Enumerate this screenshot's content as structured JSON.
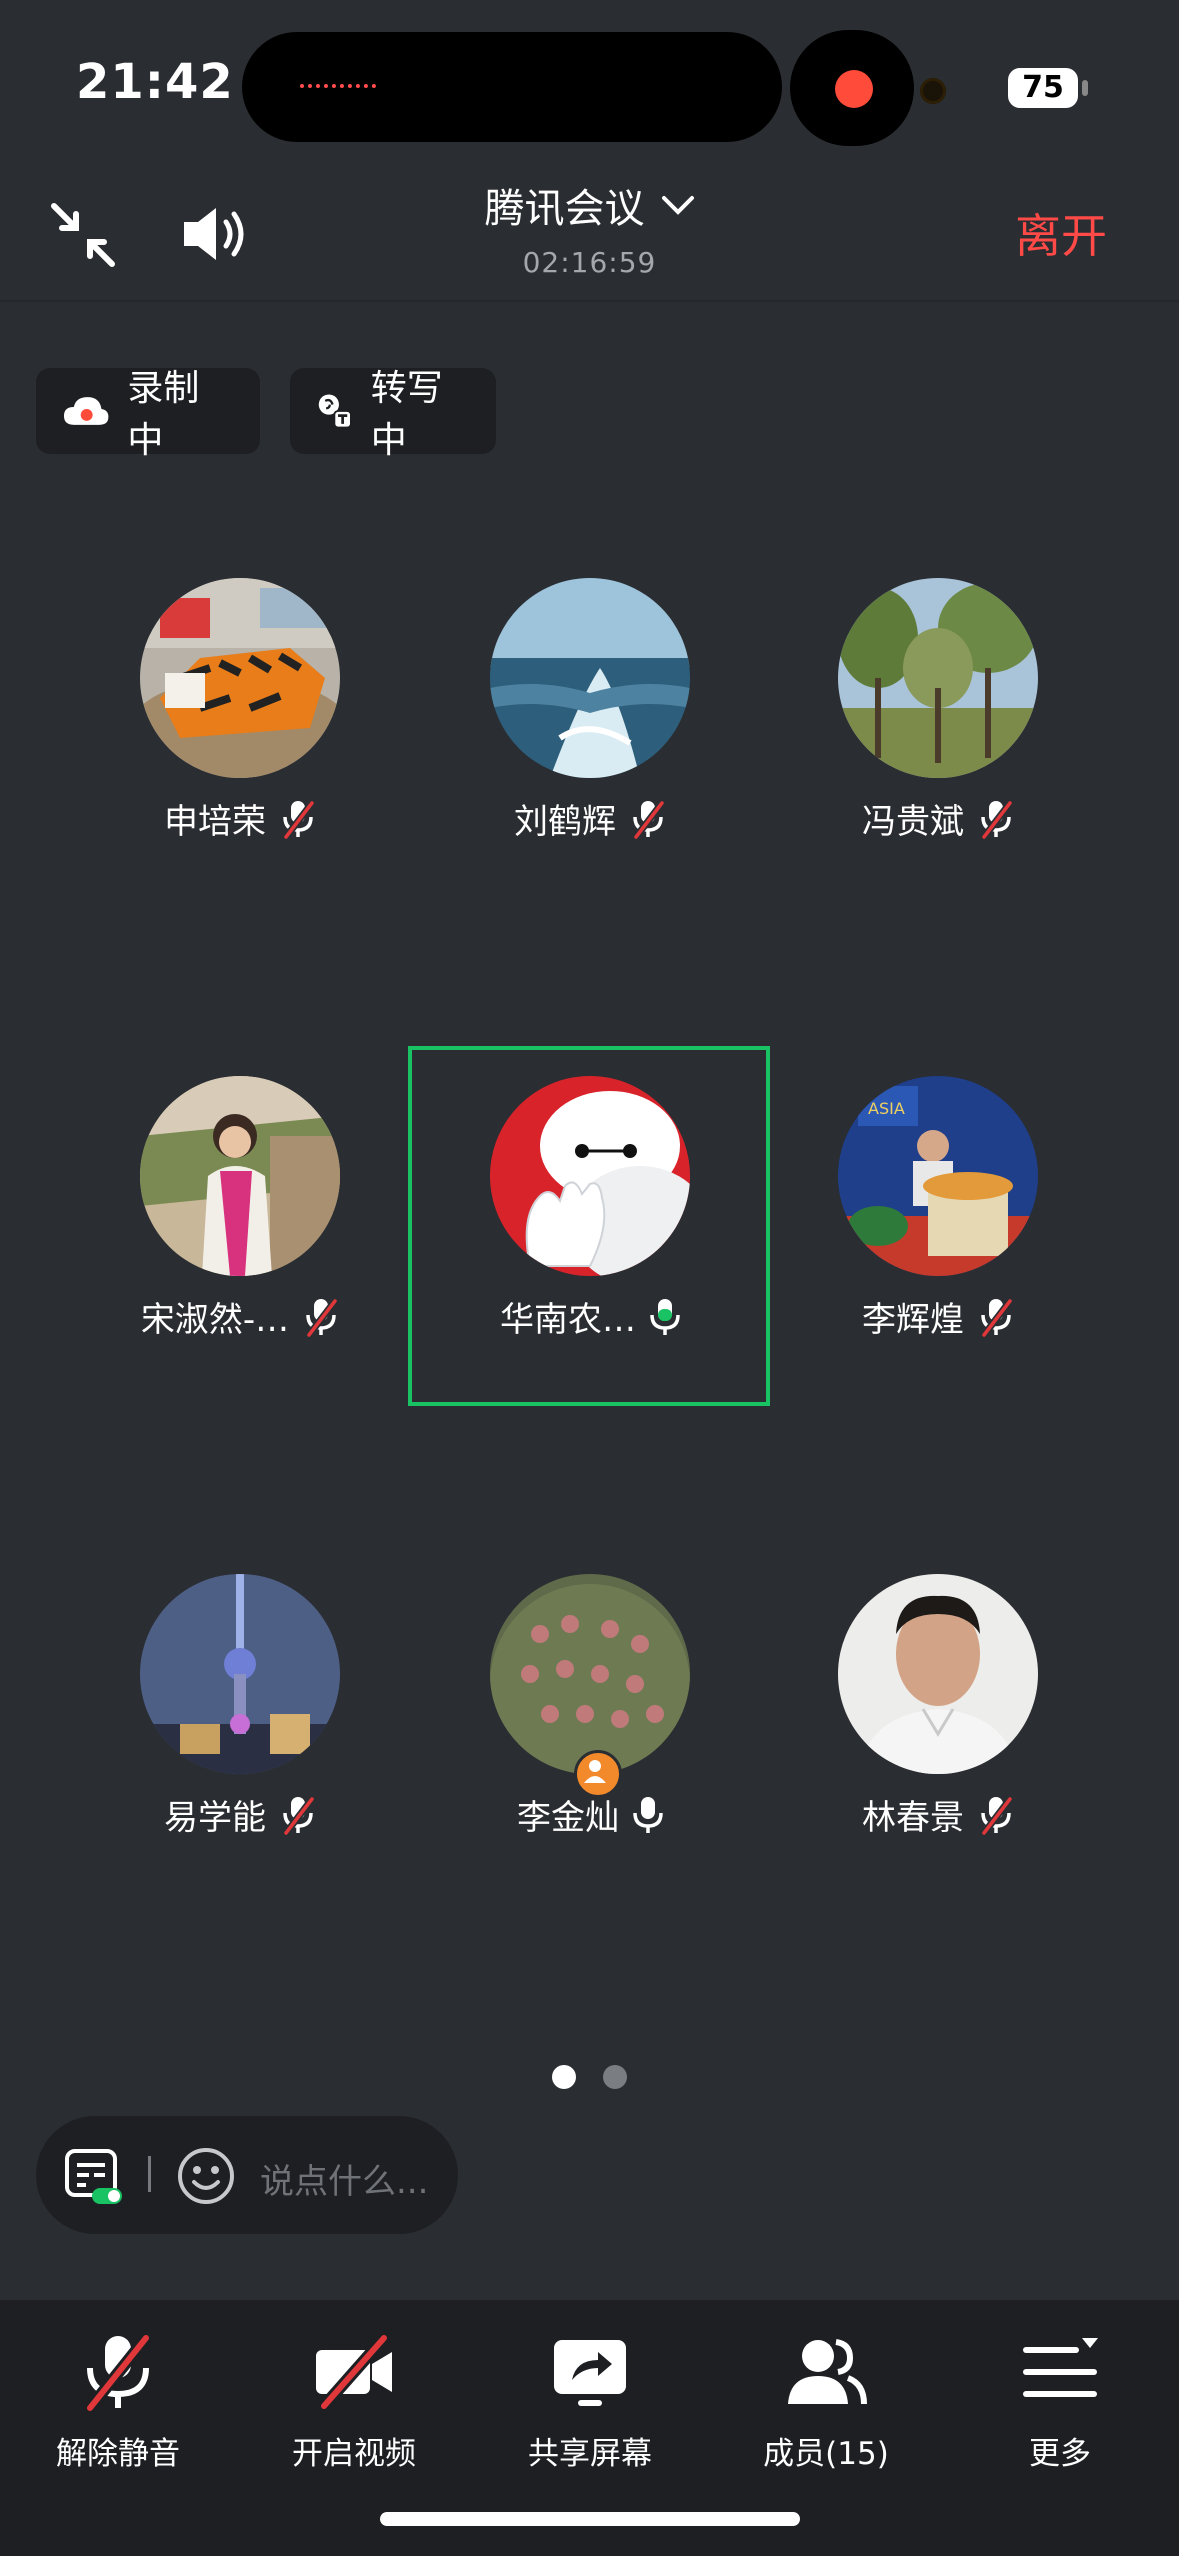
{
  "status_bar": {
    "time": "21:42",
    "battery": "75"
  },
  "header": {
    "title": "腾讯会议",
    "duration": "02:16:59",
    "leave_label": "离开"
  },
  "chips": {
    "recording": "录制中",
    "transcribing": "转写中"
  },
  "participants": [
    {
      "name": "申培荣",
      "mic": "muted"
    },
    {
      "name": "刘鹤辉",
      "mic": "muted"
    },
    {
      "name": "冯贵斌",
      "mic": "muted"
    },
    {
      "name": "宋淑然-…",
      "mic": "muted"
    },
    {
      "name": "华南农…",
      "mic": "speaking"
    },
    {
      "name": "李辉煌",
      "mic": "muted"
    },
    {
      "name": "易学能",
      "mic": "muted"
    },
    {
      "name": "李金灿",
      "mic": "on",
      "host": true
    },
    {
      "name": "林春景",
      "mic": "muted"
    }
  ],
  "pagination": {
    "pages": 2,
    "current": 1
  },
  "chat": {
    "placeholder": "说点什么..."
  },
  "toolbar": {
    "unmute": "解除静音",
    "start_video": "开启视频",
    "share_screen": "共享屏幕",
    "members": "成员(15)",
    "more": "更多"
  },
  "colors": {
    "leave": "#ff4a47",
    "speaking": "#19c262",
    "record": "#ff4b3a",
    "mute_slash": "#e0373a"
  }
}
